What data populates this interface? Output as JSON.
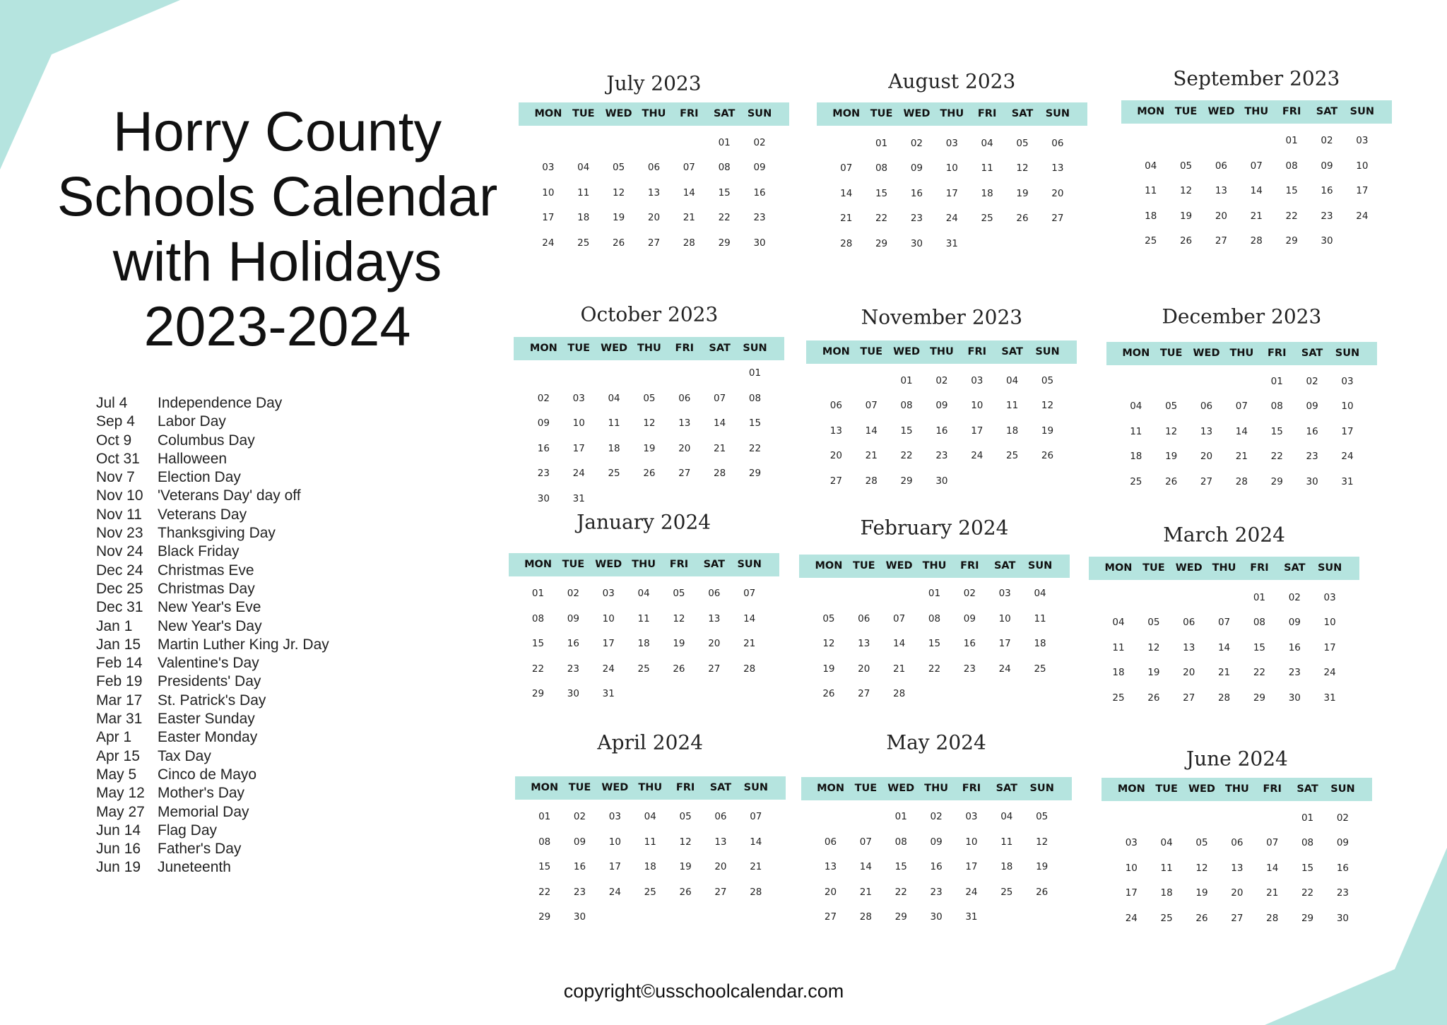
{
  "title": {
    "lines": [
      "Horry County",
      "Schools Calendar",
      "with Holidays",
      "2023-2024"
    ]
  },
  "colors": {
    "accent": "#b5e4df",
    "text": "#1a1a1a"
  },
  "weekdays": [
    "MON",
    "TUE",
    "WED",
    "THU",
    "FRI",
    "SAT",
    "SUN"
  ],
  "holidays": [
    {
      "date": "Jul 4",
      "name": "Independence Day"
    },
    {
      "date": "Sep 4",
      "name": "Labor Day"
    },
    {
      "date": "Oct 9",
      "name": "Columbus Day"
    },
    {
      "date": "Oct 31",
      "name": "Halloween"
    },
    {
      "date": "Nov 7",
      "name": "Election Day"
    },
    {
      "date": "Nov 10",
      "name": "'Veterans Day' day off"
    },
    {
      "date": "Nov 11",
      "name": "Veterans Day"
    },
    {
      "date": "Nov 23",
      "name": "Thanksgiving Day"
    },
    {
      "date": "Nov 24",
      "name": "Black Friday"
    },
    {
      "date": "Dec 24",
      "name": "Christmas Eve"
    },
    {
      "date": "Dec 25",
      "name": "Christmas Day"
    },
    {
      "date": "Dec 31",
      "name": "New Year's Eve"
    },
    {
      "date": "Jan 1",
      "name": "New Year's Day"
    },
    {
      "date": "Jan 15",
      "name": "Martin Luther King Jr. Day"
    },
    {
      "date": "Feb 14",
      "name": "Valentine's Day"
    },
    {
      "date": "Feb 19",
      "name": "Presidents' Day"
    },
    {
      "date": "Mar 17",
      "name": "St. Patrick's Day"
    },
    {
      "date": "Mar 31",
      "name": "Easter Sunday"
    },
    {
      "date": "Apr 1",
      "name": "Easter Monday"
    },
    {
      "date": "Apr 15",
      "name": "Tax Day"
    },
    {
      "date": "May 5",
      "name": "Cinco de Mayo"
    },
    {
      "date": "May 12",
      "name": "Mother's Day"
    },
    {
      "date": "May 27",
      "name": "Memorial Day"
    },
    {
      "date": "Jun 14",
      "name": "Flag Day"
    },
    {
      "date": "Jun 16",
      "name": "Father's Day"
    },
    {
      "date": "Jun 19",
      "name": "Juneteenth"
    }
  ],
  "months": [
    {
      "name": "July 2023",
      "weeks": [
        [
          "",
          "",
          "",
          "",
          "",
          "01",
          "02"
        ],
        [
          "03",
          "04",
          "05",
          "06",
          "07",
          "08",
          "09"
        ],
        [
          "10",
          "11",
          "12",
          "13",
          "14",
          "15",
          "16"
        ],
        [
          "17",
          "18",
          "19",
          "20",
          "21",
          "22",
          "23"
        ],
        [
          "24",
          "25",
          "26",
          "27",
          "28",
          "29",
          "30"
        ]
      ]
    },
    {
      "name": "August 2023",
      "weeks": [
        [
          "",
          "01",
          "02",
          "03",
          "04",
          "05",
          "06"
        ],
        [
          "07",
          "08",
          "09",
          "10",
          "11",
          "12",
          "13"
        ],
        [
          "14",
          "15",
          "16",
          "17",
          "18",
          "19",
          "20"
        ],
        [
          "21",
          "22",
          "23",
          "24",
          "25",
          "26",
          "27"
        ],
        [
          "28",
          "29",
          "30",
          "31",
          "",
          "",
          ""
        ]
      ]
    },
    {
      "name": "September 2023",
      "weeks": [
        [
          "",
          "",
          "",
          "",
          "01",
          "02",
          "03"
        ],
        [
          "04",
          "05",
          "06",
          "07",
          "08",
          "09",
          "10"
        ],
        [
          "11",
          "12",
          "13",
          "14",
          "15",
          "16",
          "17"
        ],
        [
          "18",
          "19",
          "20",
          "21",
          "22",
          "23",
          "24"
        ],
        [
          "25",
          "26",
          "27",
          "28",
          "29",
          "30",
          ""
        ]
      ]
    },
    {
      "name": "October 2023",
      "weeks": [
        [
          "",
          "",
          "",
          "",
          "",
          "",
          "01"
        ],
        [
          "02",
          "03",
          "04",
          "05",
          "06",
          "07",
          "08"
        ],
        [
          "09",
          "10",
          "11",
          "12",
          "13",
          "14",
          "15"
        ],
        [
          "16",
          "17",
          "18",
          "19",
          "20",
          "21",
          "22"
        ],
        [
          "23",
          "24",
          "25",
          "26",
          "27",
          "28",
          "29"
        ],
        [
          "30",
          "31",
          "",
          "",
          "",
          "",
          ""
        ]
      ]
    },
    {
      "name": "November 2023",
      "weeks": [
        [
          "",
          "",
          "01",
          "02",
          "03",
          "04",
          "05"
        ],
        [
          "06",
          "07",
          "08",
          "09",
          "10",
          "11",
          "12"
        ],
        [
          "13",
          "14",
          "15",
          "16",
          "17",
          "18",
          "19"
        ],
        [
          "20",
          "21",
          "22",
          "23",
          "24",
          "25",
          "26"
        ],
        [
          "27",
          "28",
          "29",
          "30",
          "",
          "",
          ""
        ]
      ]
    },
    {
      "name": "December 2023",
      "weeks": [
        [
          "",
          "",
          "",
          "",
          "01",
          "02",
          "03"
        ],
        [
          "04",
          "05",
          "06",
          "07",
          "08",
          "09",
          "10"
        ],
        [
          "11",
          "12",
          "13",
          "14",
          "15",
          "16",
          "17"
        ],
        [
          "18",
          "19",
          "20",
          "21",
          "22",
          "23",
          "24"
        ],
        [
          "25",
          "26",
          "27",
          "28",
          "29",
          "30",
          "31"
        ]
      ]
    },
    {
      "name": "January 2024",
      "weeks": [
        [
          "01",
          "02",
          "03",
          "04",
          "05",
          "06",
          "07"
        ],
        [
          "08",
          "09",
          "10",
          "11",
          "12",
          "13",
          "14"
        ],
        [
          "15",
          "16",
          "17",
          "18",
          "19",
          "20",
          "21"
        ],
        [
          "22",
          "23",
          "24",
          "25",
          "26",
          "27",
          "28"
        ],
        [
          "29",
          "30",
          "31",
          "",
          "",
          "",
          ""
        ]
      ]
    },
    {
      "name": "February 2024",
      "weeks": [
        [
          "",
          "",
          "",
          "01",
          "02",
          "03",
          "04"
        ],
        [
          "05",
          "06",
          "07",
          "08",
          "09",
          "10",
          "11"
        ],
        [
          "12",
          "13",
          "14",
          "15",
          "16",
          "17",
          "18"
        ],
        [
          "19",
          "20",
          "21",
          "22",
          "23",
          "24",
          "25"
        ],
        [
          "26",
          "27",
          "28",
          "",
          "",
          "",
          ""
        ]
      ]
    },
    {
      "name": "March 2024",
      "weeks": [
        [
          "",
          "",
          "",
          "",
          "01",
          "02",
          "03"
        ],
        [
          "04",
          "05",
          "06",
          "07",
          "08",
          "09",
          "10"
        ],
        [
          "11",
          "12",
          "13",
          "14",
          "15",
          "16",
          "17"
        ],
        [
          "18",
          "19",
          "20",
          "21",
          "22",
          "23",
          "24"
        ],
        [
          "25",
          "26",
          "27",
          "28",
          "29",
          "30",
          "31"
        ]
      ]
    },
    {
      "name": "April 2024",
      "weeks": [
        [
          "01",
          "02",
          "03",
          "04",
          "05",
          "06",
          "07"
        ],
        [
          "08",
          "09",
          "10",
          "11",
          "12",
          "13",
          "14"
        ],
        [
          "15",
          "16",
          "17",
          "18",
          "19",
          "20",
          "21"
        ],
        [
          "22",
          "23",
          "24",
          "25",
          "26",
          "27",
          "28"
        ],
        [
          "29",
          "30",
          "",
          "",
          "",
          "",
          ""
        ]
      ]
    },
    {
      "name": "May 2024",
      "weeks": [
        [
          "",
          "",
          "01",
          "02",
          "03",
          "04",
          "05"
        ],
        [
          "06",
          "07",
          "08",
          "09",
          "10",
          "11",
          "12"
        ],
        [
          "13",
          "14",
          "15",
          "16",
          "17",
          "18",
          "19"
        ],
        [
          "20",
          "21",
          "22",
          "23",
          "24",
          "25",
          "26"
        ],
        [
          "27",
          "28",
          "29",
          "30",
          "31",
          "",
          ""
        ]
      ]
    },
    {
      "name": "June 2024",
      "weeks": [
        [
          "",
          "",
          "",
          "",
          "",
          "01",
          "02"
        ],
        [
          "03",
          "04",
          "05",
          "06",
          "07",
          "08",
          "09"
        ],
        [
          "10",
          "11",
          "12",
          "13",
          "14",
          "15",
          "16"
        ],
        [
          "17",
          "18",
          "19",
          "20",
          "21",
          "22",
          "23"
        ],
        [
          "24",
          "25",
          "26",
          "27",
          "28",
          "29",
          "30"
        ]
      ]
    }
  ],
  "footer": {
    "copyright": "copyright©usschoolcalendar.com"
  }
}
